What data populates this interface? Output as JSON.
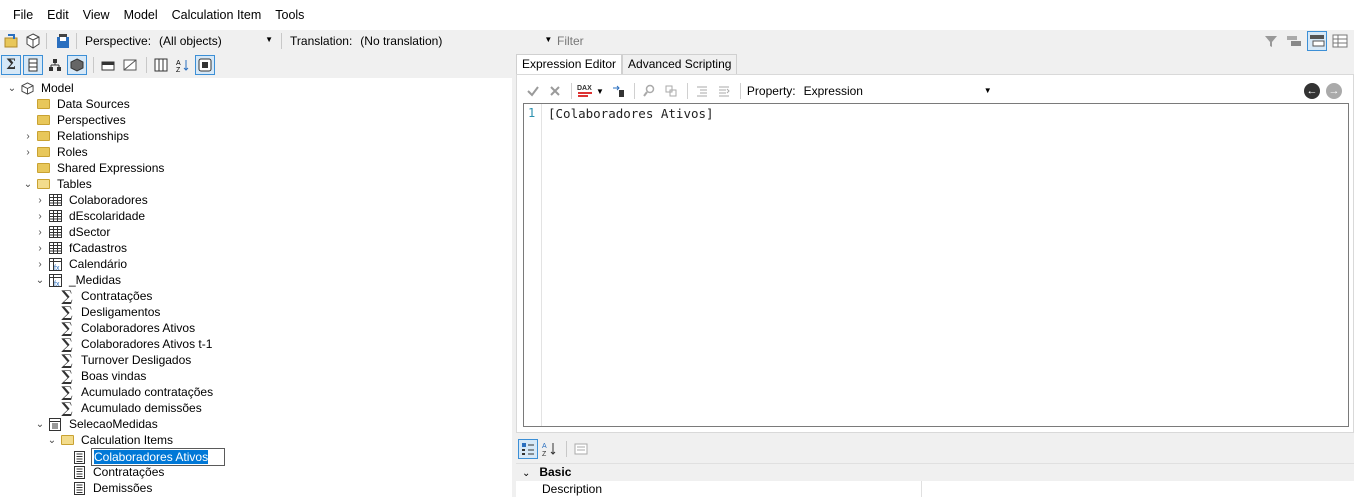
{
  "menu": [
    "File",
    "Edit",
    "View",
    "Model",
    "Calculation Item",
    "Tools"
  ],
  "toolbar": {
    "perspective_label": "Perspective:",
    "perspective_value": "(All objects)",
    "translation_label": "Translation:",
    "translation_value": "(No translation)",
    "filter_placeholder": "Filter"
  },
  "tree": {
    "model": "Model",
    "data_sources": "Data Sources",
    "perspectives": "Perspectives",
    "relationships": "Relationships",
    "roles": "Roles",
    "shared_expressions": "Shared Expressions",
    "tables": "Tables",
    "table_items": [
      "Colaboradores",
      "dEscolaridade",
      "dSector",
      "fCadastros",
      "Calendário"
    ],
    "medidas": "_Medidas",
    "measures": [
      "Contratações",
      "Desligamentos",
      "Colaboradores Ativos",
      "Colaboradores Ativos t-1",
      "Turnover Desligados",
      "Boas vindas",
      "Acumulado contratações",
      "Acumulado demissões"
    ],
    "selecao": "SelecaoMedidas",
    "calc_items_folder": "Calculation Items",
    "calc_items": [
      "Colaboradores Ativos",
      "Contratações",
      "Demissões"
    ]
  },
  "tabs": [
    "Expression Editor",
    "Advanced Scripting"
  ],
  "editor": {
    "property_label": "Property:",
    "property_value": "Expression",
    "line_number": "1",
    "code": "[Colaboradores Ativos]"
  },
  "property_grid": {
    "category": "Basic",
    "row": "Description"
  },
  "colors": {
    "selection": "#0078d7",
    "folder": "#e8c75a",
    "accent_toggle": "#d6e8f7"
  }
}
